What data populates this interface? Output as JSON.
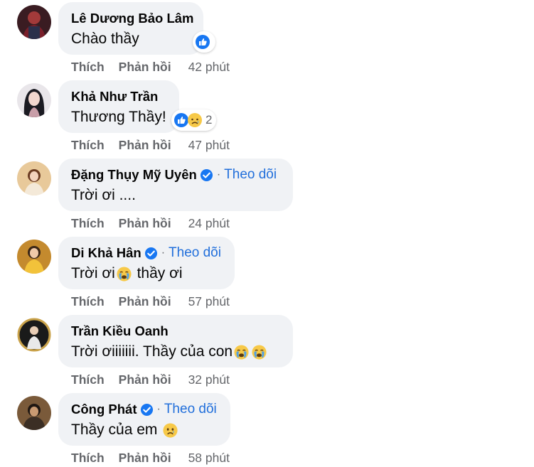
{
  "actions": {
    "like": "Thích",
    "reply": "Phản hồi"
  },
  "follow_label": "Theo dõi",
  "colors": {
    "bubble": "#f0f2f5",
    "link": "#216fdb",
    "meta": "#65676b",
    "like_blue": "#1877f2",
    "emoji_yellow": "#f7c948"
  },
  "comments": [
    {
      "name": "Lê Dương Bảo Lâm",
      "text": "Chào thầy",
      "time": "42 phút",
      "verified": false,
      "reactions": [
        "like-icon"
      ],
      "reaction_count": ""
    },
    {
      "name": "Khả Như Trần",
      "text": "Thương Thầy!",
      "time": "47 phút",
      "verified": false,
      "reactions": [
        "like-icon",
        "sad-icon"
      ],
      "reaction_count": "2"
    },
    {
      "name": "Đặng Thụy Mỹ Uyên",
      "text": "Trời ơi ....",
      "time": "24 phút",
      "verified": true,
      "reactions": [],
      "reaction_count": ""
    },
    {
      "name": "Di Khả Hân",
      "text_before": "Trời ơi",
      "text_after": " thầy ơi",
      "emoji": [
        "crying-face-icon"
      ],
      "time": "57 phút",
      "verified": true
    },
    {
      "name": "Trần Kiều Oanh",
      "text": "Trời ơiiiiiii. Thầy của con",
      "emoji": [
        "crying-face-icon",
        "crying-face-icon"
      ],
      "time": "32 phút",
      "verified": false
    },
    {
      "name": "Công Phát",
      "text": "Thầy của em",
      "emoji": [
        "sad-face-icon"
      ],
      "time": "58 phút",
      "verified": true
    }
  ]
}
